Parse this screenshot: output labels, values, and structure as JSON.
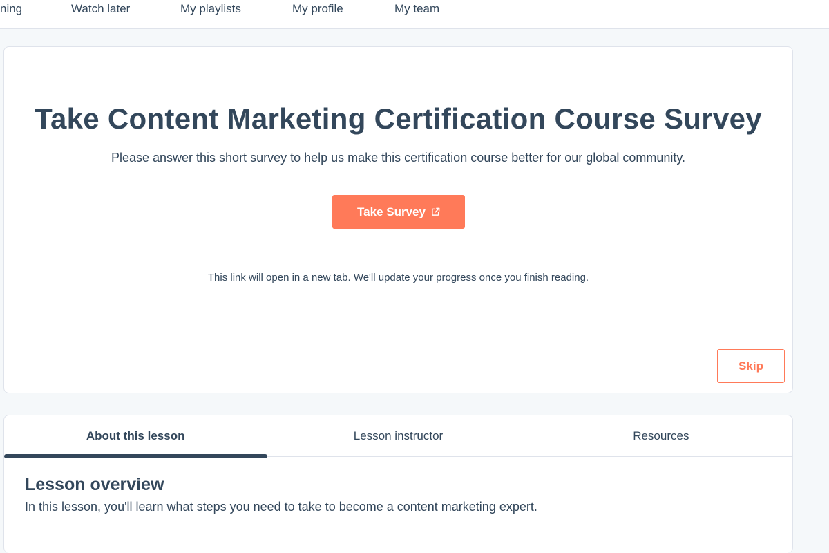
{
  "nav": {
    "items": [
      {
        "label": "ning"
      },
      {
        "label": "Watch later"
      },
      {
        "label": "My playlists"
      },
      {
        "label": "My profile"
      },
      {
        "label": "My team"
      }
    ]
  },
  "survey": {
    "title": "Take Content Marketing Certification Course Survey",
    "description": "Please answer this short survey to help us make this certification course better for our global community.",
    "button_label": "Take Survey",
    "button_icon": "external-link-icon",
    "note": "This link will open in a new tab. We'll update your progress once you finish reading.",
    "skip_label": "Skip"
  },
  "lesson": {
    "tabs": [
      {
        "label": "About this lesson",
        "active": true
      },
      {
        "label": "Lesson instructor",
        "active": false
      },
      {
        "label": "Resources",
        "active": false
      }
    ],
    "heading": "Lesson overview",
    "text": "In this lesson, you'll learn what steps you need to take to become a content marketing expert."
  },
  "colors": {
    "accent": "#ff7a59",
    "text": "#33475b",
    "background": "#f5f8fa",
    "border": "#dfe3eb"
  }
}
